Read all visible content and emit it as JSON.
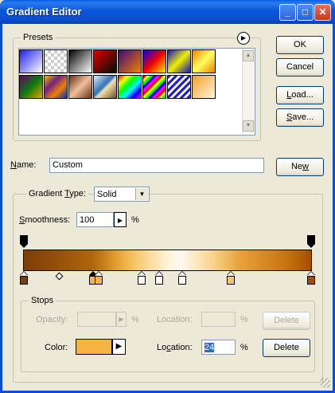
{
  "window": {
    "title": "Gradient Editor"
  },
  "presets": {
    "label": "Presets",
    "swatches": [
      {
        "name": "violet-white",
        "bg": "linear-gradient(135deg,#1e1ef0,#fff)"
      },
      {
        "name": "violet-transparent",
        "bg": "repeating-conic-gradient(#ccc 0 25%,#fff 0 50%) 0 0/8px 8px, linear-gradient(135deg,#3c3cf5,#cfcfff)"
      },
      {
        "name": "black-white",
        "bg": "linear-gradient(135deg,#000,#fff)"
      },
      {
        "name": "red-green",
        "bg": "linear-gradient(135deg,#e00000,#001000)"
      },
      {
        "name": "violet-orange",
        "bg": "linear-gradient(135deg,#3c0878,#f08000)"
      },
      {
        "name": "blue-red-yellow",
        "bg": "linear-gradient(135deg,#0000f0,#f00000 50%,#f0f000)"
      },
      {
        "name": "blue-yellow-blue",
        "bg": "linear-gradient(135deg,#1010c0,#f0f000 50%,#1010c0)"
      },
      {
        "name": "orange-yellow-orange",
        "bg": "linear-gradient(135deg,#f08000,#ffff60 50%,#f08000)"
      },
      {
        "name": "violet-green-orange",
        "bg": "linear-gradient(135deg,#6a006a,#0a7a0a 50%,#f0a000)"
      },
      {
        "name": "yellow-violet-orange-blue",
        "bg": "linear-gradient(135deg,#f0c000,#702080 35%,#f08000 65%,#0030d0)"
      },
      {
        "name": "copper",
        "bg": "linear-gradient(135deg,#6a3010,#f0c0a0 50%,#6a3010)"
      },
      {
        "name": "chrome",
        "bg": "linear-gradient(135deg,#e0f0ff,#3070b0 45%,#f0e0b0 55%,#705020)"
      },
      {
        "name": "spectrum",
        "bg": "linear-gradient(135deg,#f00,#ff0,#0f0,#0ff,#00f,#f0f)"
      },
      {
        "name": "transparent-rainbow",
        "bg": "repeating-linear-gradient(135deg,#f00 0 3px,#ff0 3px 6px,#0f0 6px 9px,#00f 9px 12px,#f0f 12px 15px)"
      },
      {
        "name": "transparent-stripes",
        "bg": "repeating-linear-gradient(135deg,#2020d0 0 3px,#fff 3px 6px)"
      },
      {
        "name": "orange-transparent",
        "bg": "linear-gradient(135deg,#f0a030,#fff6d8)"
      }
    ]
  },
  "buttons": {
    "ok": "OK",
    "cancel": "Cancel",
    "load_pre": "",
    "load_u": "L",
    "load_post": "oad...",
    "save_u": "S",
    "save_post": "ave...",
    "new_pre": "Ne",
    "new_u": "w",
    "delete": "Delete"
  },
  "name_field": {
    "label_u": "N",
    "label_post": "ame:",
    "value": "Custom"
  },
  "gradient_type": {
    "label_pre": "Gradient ",
    "label_u": "T",
    "label_post": "ype:",
    "value": "Solid"
  },
  "smoothness": {
    "label_pre": "",
    "label_u": "S",
    "label_post": "moothness:",
    "value": "100",
    "unit": "%"
  },
  "stops": {
    "label": "Stops",
    "opacity_label": "Opacity:",
    "opacity_value": "",
    "opacity_unit": "%",
    "opacity_location_label": "Location:",
    "opacity_location_value": "",
    "opacity_location_unit": "%",
    "color_label": "Color:",
    "color_value": "#f5b342",
    "color_location_label_pre": "Lo",
    "color_location_label_u": "c",
    "color_location_label_post": "ation:",
    "color_location_value": "24",
    "color_location_unit": "%"
  },
  "gradient": {
    "opacity_stops": [
      0,
      100
    ],
    "color_stops": [
      {
        "location": 0,
        "color": "#7c3d06"
      },
      {
        "location": 24,
        "color": "#f5b342"
      },
      {
        "location": 26,
        "color": "#f5b342"
      },
      {
        "location": 41,
        "color": "#fffaf0"
      },
      {
        "location": 47,
        "color": "#fffaf0"
      },
      {
        "location": 55,
        "color": "#fffaf0"
      },
      {
        "location": 72,
        "color": "#f8c56a"
      },
      {
        "location": 100,
        "color": "#a24f04"
      }
    ],
    "selected_stop": 1
  }
}
